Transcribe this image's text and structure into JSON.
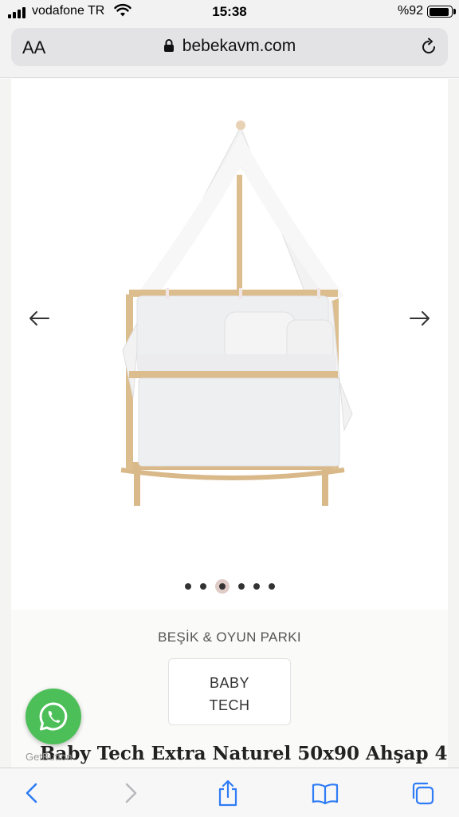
{
  "status_bar": {
    "carrier": "vodafone TR",
    "time": "15:38",
    "battery": "%92",
    "battery_level": 0.92
  },
  "browser": {
    "aa_label": "AA",
    "url": "bebekavm.com"
  },
  "gallery": {
    "slide_count": 6,
    "active_slide": 3
  },
  "product": {
    "category": "BEŞİK & OYUN PARKI",
    "brand_line1": "BABY",
    "brand_line2": "TECH",
    "title": "Baby Tech Extra Naturel 50x90 Ahşap 4"
  },
  "widgets": {
    "getbutton_label": "GetButton"
  },
  "icons": {
    "prev": "arrow-left-icon",
    "next": "arrow-right-icon",
    "whatsapp": "whatsapp-icon",
    "share": "share-icon",
    "bookmarks": "book-icon",
    "tabs": "tabs-icon"
  },
  "colors": {
    "accent": "#2f7cf6",
    "whatsapp_green": "#4dbf59"
  }
}
